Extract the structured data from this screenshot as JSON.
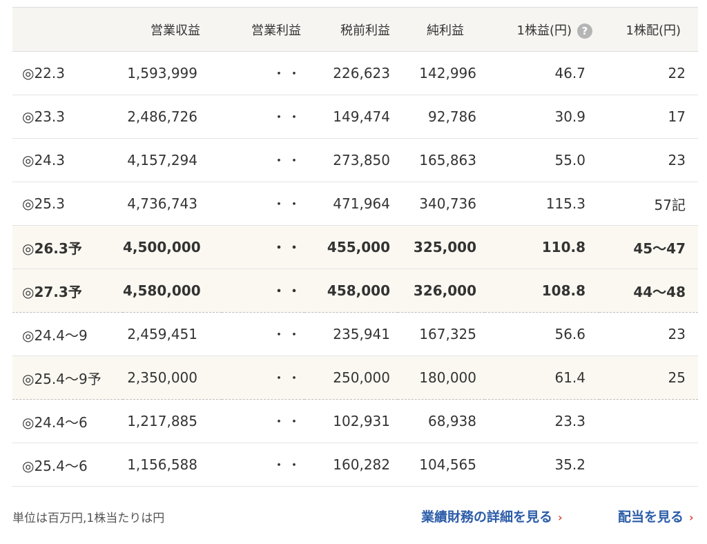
{
  "table": {
    "headers": [
      "",
      "営業収益",
      "営業利益",
      "税前利益",
      "純利益",
      "1株益(円)",
      "1株配(円)"
    ],
    "help_icon": "?",
    "rows": [
      {
        "period": "◎22.3",
        "revenue": "1,593,999",
        "op_profit": "・・",
        "pretax": "226,623",
        "net": "142,996",
        "eps": "46.7",
        "dps": "22",
        "style": "normal"
      },
      {
        "period": "◎23.3",
        "revenue": "2,486,726",
        "op_profit": "・・",
        "pretax": "149,474",
        "net": "92,786",
        "eps": "30.9",
        "dps": "17",
        "style": "normal"
      },
      {
        "period": "◎24.3",
        "revenue": "4,157,294",
        "op_profit": "・・",
        "pretax": "273,850",
        "net": "165,863",
        "eps": "55.0",
        "dps": "23",
        "style": "normal"
      },
      {
        "period": "◎25.3",
        "revenue": "4,736,743",
        "op_profit": "・・",
        "pretax": "471,964",
        "net": "340,736",
        "eps": "115.3",
        "dps": "57記",
        "style": "normal"
      },
      {
        "period": "◎26.3予",
        "revenue": "4,500,000",
        "op_profit": "・・",
        "pretax": "455,000",
        "net": "325,000",
        "eps": "110.8",
        "dps": "45〜47",
        "style": "forecast-bold"
      },
      {
        "period": "◎27.3予",
        "revenue": "4,580,000",
        "op_profit": "・・",
        "pretax": "458,000",
        "net": "326,000",
        "eps": "108.8",
        "dps": "44〜48",
        "style": "forecast-bold-dashed"
      },
      {
        "period": "◎24.4〜9",
        "revenue": "2,459,451",
        "op_profit": "・・",
        "pretax": "235,941",
        "net": "167,325",
        "eps": "56.6",
        "dps": "23",
        "style": "normal"
      },
      {
        "period": "◎25.4〜9予",
        "revenue": "2,350,000",
        "op_profit": "・・",
        "pretax": "250,000",
        "net": "180,000",
        "eps": "61.4",
        "dps": "25",
        "style": "forecast-dashed"
      },
      {
        "period": "◎24.4〜6",
        "revenue": "1,217,885",
        "op_profit": "・・",
        "pretax": "102,931",
        "net": "68,938",
        "eps": "23.3",
        "dps": "",
        "style": "normal"
      },
      {
        "period": "◎25.4〜6",
        "revenue": "1,156,588",
        "op_profit": "・・",
        "pretax": "160,282",
        "net": "104,565",
        "eps": "35.2",
        "dps": "",
        "style": "normal"
      }
    ]
  },
  "footer": {
    "unit_note": "単位は百万円,1株当たりは円",
    "details_link": "業績財務の詳細を見る",
    "dividend_link": "配当を見る",
    "chevron": "›"
  },
  "colors": {
    "header_bg": "#f6f5f2",
    "forecast_bg": "#fbf8f1",
    "link": "#2b5ca8",
    "chevron": "#e04a3a"
  },
  "icons": {
    "help": "question-circle-icon",
    "link_arrow": "chevron-right-icon"
  }
}
